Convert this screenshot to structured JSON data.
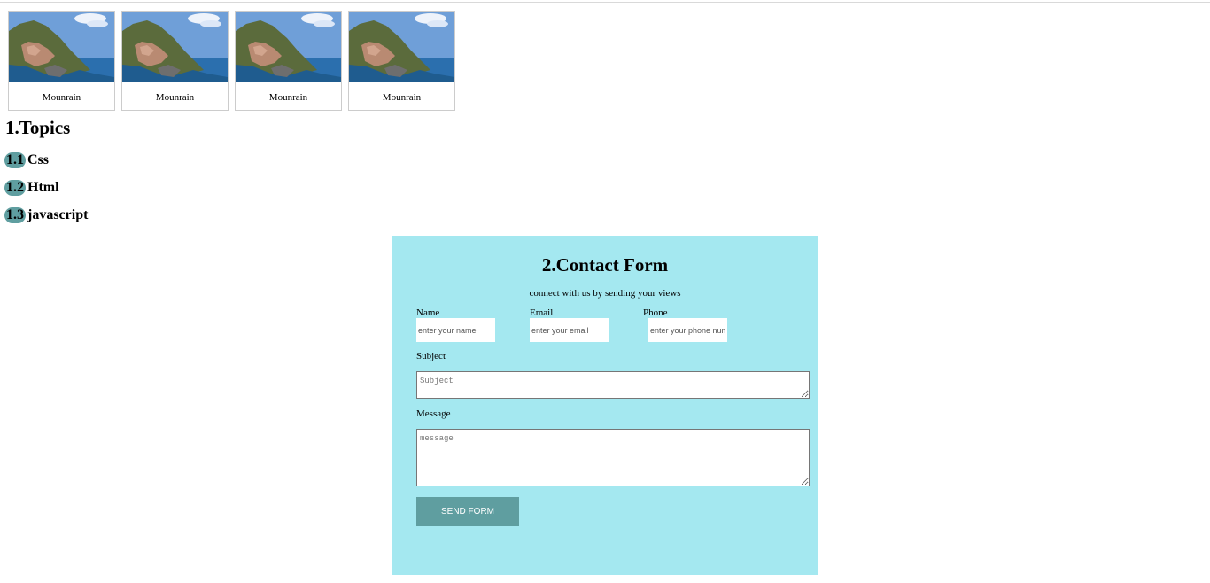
{
  "gallery": {
    "cards": [
      {
        "caption": "Mounrain"
      },
      {
        "caption": "Mounrain"
      },
      {
        "caption": "Mounrain"
      },
      {
        "caption": "Mounrain"
      }
    ]
  },
  "topics": {
    "title": "1.Topics",
    "items": [
      {
        "number": "1.1",
        "label": "Css"
      },
      {
        "number": "1.2",
        "label": "Html"
      },
      {
        "number": "1.3",
        "label": "javascript"
      }
    ]
  },
  "contact": {
    "title": "2.Contact Form",
    "subtitle": "connect with us by sending your views",
    "name_label": "Name",
    "name_placeholder": "enter your name",
    "email_label": "Email",
    "email_placeholder": "enter your email",
    "phone_label": "Phone",
    "phone_placeholder": "enter your phone number",
    "subject_label": "Subject",
    "subject_placeholder": "Subject",
    "message_label": "Message",
    "message_placeholder": "message",
    "send_label": "SEND FORM",
    "background_color": "#a4e8f0",
    "accent_color": "#5f9ea0"
  }
}
